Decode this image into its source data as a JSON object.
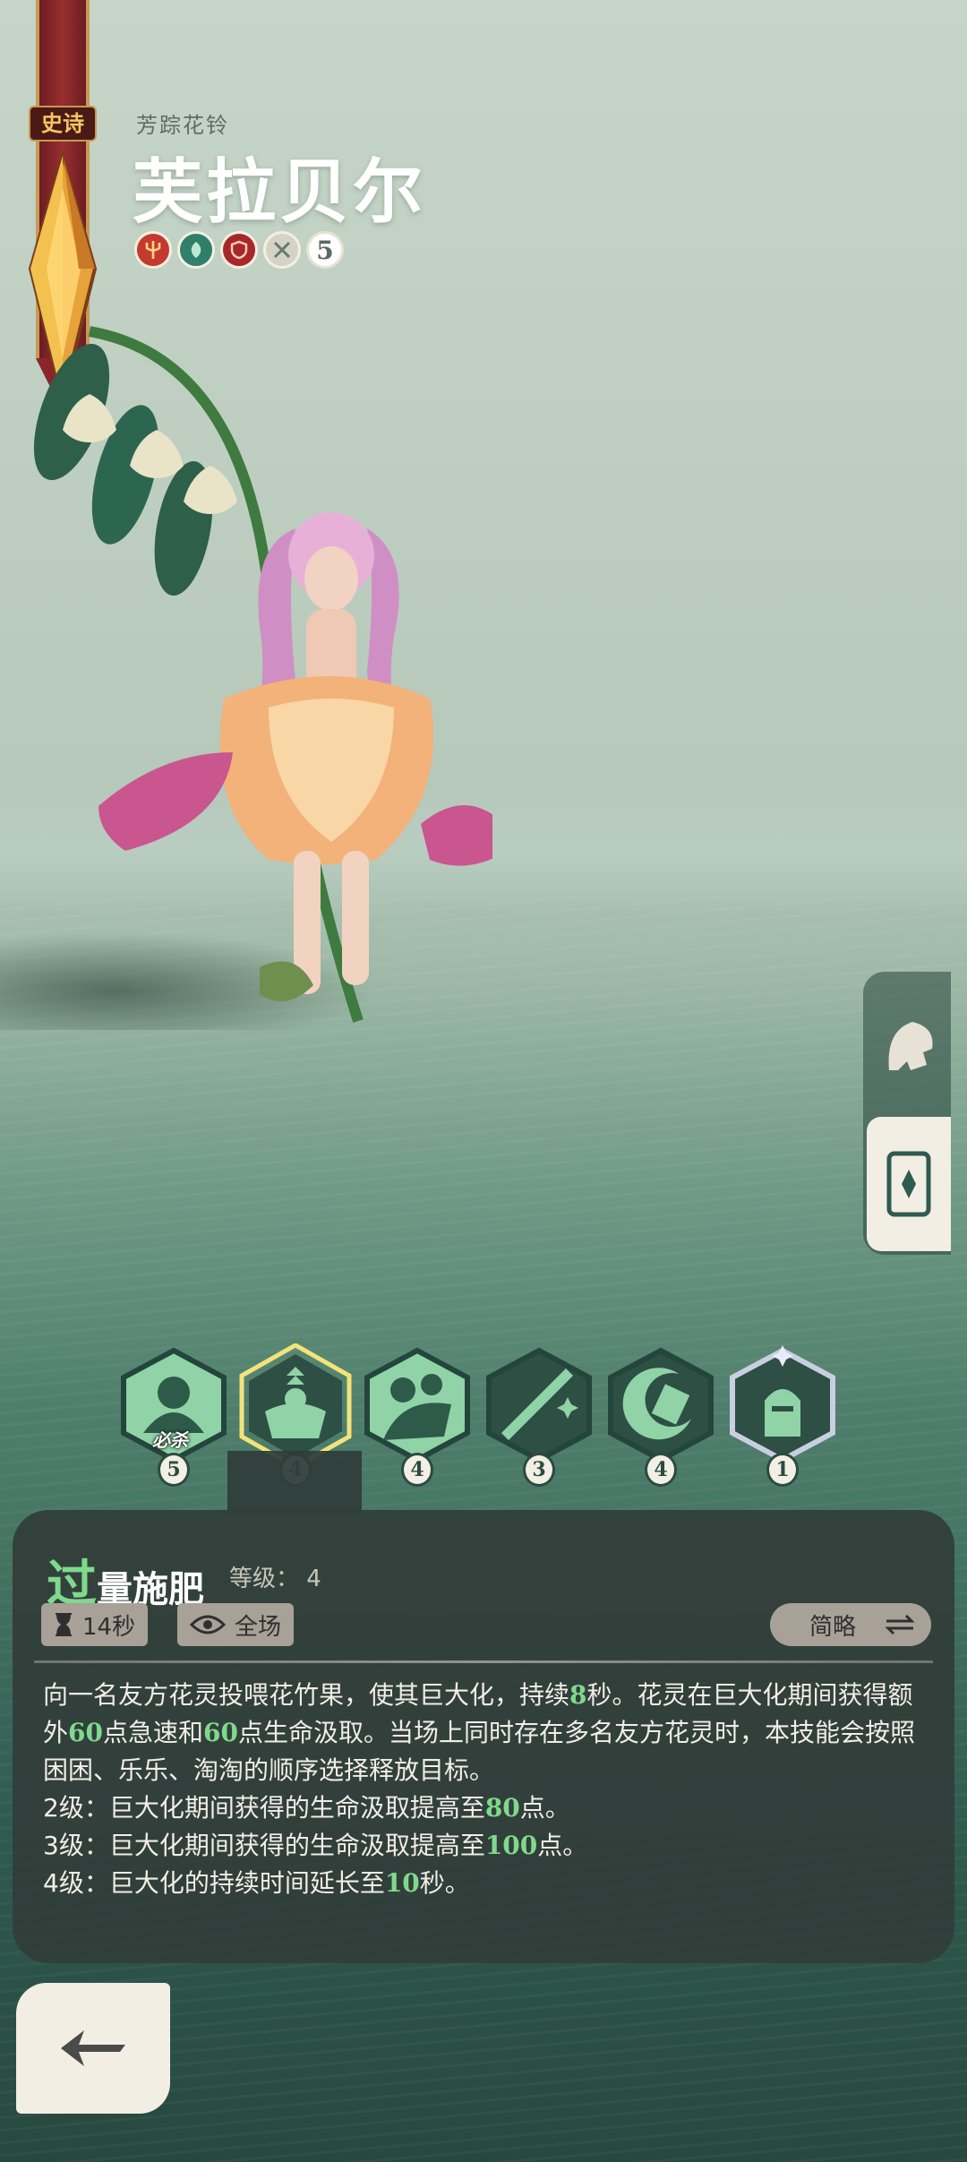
{
  "hero": {
    "rarity": "史诗",
    "subtitle": "芳踪花铃",
    "name": "芙拉贝尔",
    "traits": [
      {
        "icon": "trident-icon",
        "color": "#c43a2e"
      },
      {
        "icon": "leaf-icon",
        "color": "#2f7f6a"
      },
      {
        "icon": "shield-emblem-icon",
        "color": "#a8282a"
      },
      {
        "icon": "crossed-swords-icon",
        "color": "#d7d2c6"
      }
    ],
    "stars": "5"
  },
  "side_tabs": [
    {
      "icon": "helmet-icon",
      "active": false
    },
    {
      "icon": "scroll-icon",
      "active": true
    }
  ],
  "skills": [
    {
      "icon": "ultimate-skill-icon",
      "level": "5",
      "tag": "必杀"
    },
    {
      "icon": "flex-growth-icon",
      "level": "4",
      "selected": true
    },
    {
      "icon": "hug-skill-icon",
      "level": "4"
    },
    {
      "icon": "sword-slash-icon",
      "level": "3"
    },
    {
      "icon": "crescent-strike-icon",
      "level": "4"
    },
    {
      "icon": "knight-helmet-icon",
      "level": "1"
    }
  ],
  "detail": {
    "name_first": "过",
    "name_rest": "量施肥",
    "level_label": "等级：",
    "level_value": "4",
    "cooldown": "14秒",
    "range": "全场",
    "mode_toggle": "简略",
    "description": {
      "p1a": "向一名友方花灵投喂花竹果，使其巨大化，持续",
      "p1b": "8",
      "p1c": "秒。花灵在巨大化期间获得额外",
      "p1d": "60",
      "p1e": "点急速和",
      "p1f": "60",
      "p1g": "点生命汲取。当场上同时存在多名友方花灵时，本技能会按照困困、乐乐、淘淘的顺序选择释放目标。",
      "l2a": "2级：巨大化期间获得的生命汲取提高至",
      "l2b": "80",
      "l2c": "点。",
      "l3a": "3级：巨大化期间获得的生命汲取提高至",
      "l3b": "100",
      "l3c": "点。",
      "l4a": "4级：巨大化的持续时间延长至",
      "l4b": "10",
      "l4c": "秒。"
    }
  },
  "colors": {
    "highlight": "#7fd98c",
    "panel": "#323e3a",
    "chip": "#a8a197"
  }
}
